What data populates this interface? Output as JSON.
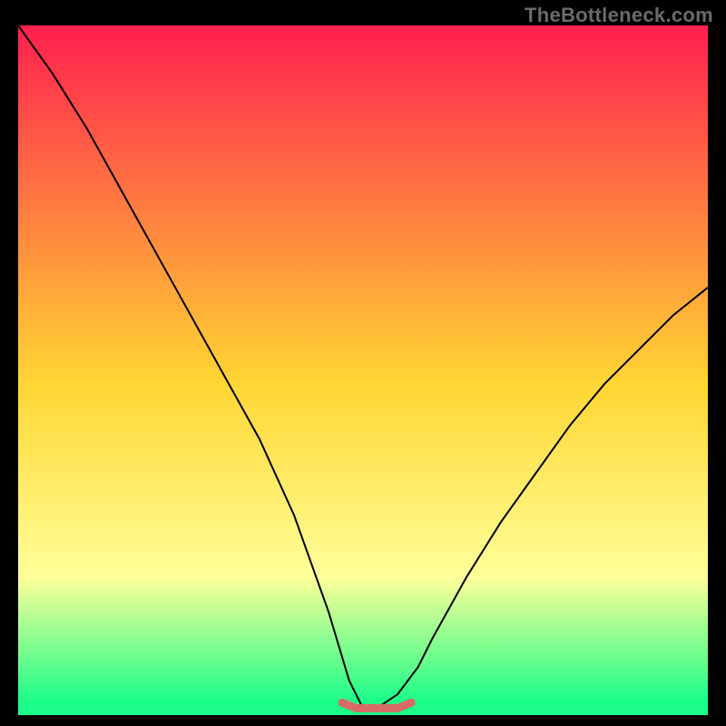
{
  "watermark": "TheBottleneck.com",
  "colors": {
    "bg": "#000000",
    "grad_top": "#ff1f4f",
    "grad_mid": "#ffd633",
    "grad_low": "#ffff99",
    "grad_green": "#1cfc88",
    "curve": "#000000",
    "marker": "#d86b63"
  },
  "chart_data": {
    "type": "line",
    "title": "",
    "xlabel": "",
    "ylabel": "",
    "xlim": [
      0,
      100
    ],
    "ylim": [
      0,
      100
    ],
    "series": [
      {
        "name": "bottleneck_curve",
        "x": [
          0,
          5,
          10,
          15,
          20,
          25,
          30,
          35,
          40,
          45,
          48,
          50,
          52,
          55,
          58,
          60,
          65,
          70,
          75,
          80,
          85,
          90,
          95,
          100
        ],
        "values": [
          100,
          93,
          85,
          76,
          67,
          58,
          49,
          40,
          29,
          15,
          5,
          1,
          1,
          3,
          7,
          11,
          20,
          28,
          35,
          42,
          48,
          53,
          58,
          62
        ]
      }
    ],
    "flat_zone": {
      "x_start": 47,
      "x_end": 57,
      "y": 1
    },
    "annotations": []
  }
}
